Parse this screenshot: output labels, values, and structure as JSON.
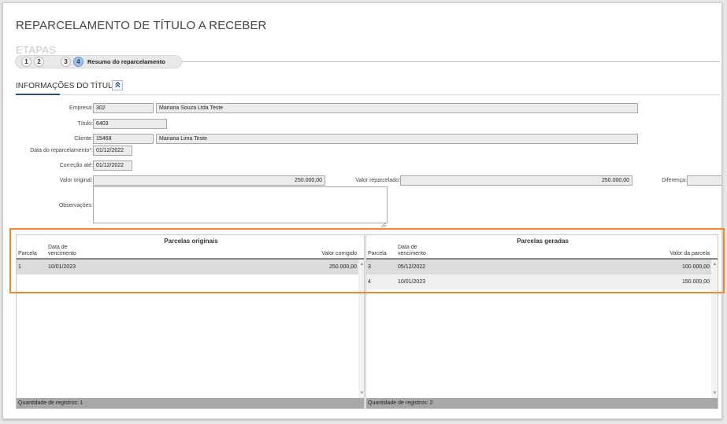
{
  "page": {
    "title": "REPARCELAMENTO DE TÍTULO A RECEBER"
  },
  "steps": {
    "heading": "ETAPAS",
    "items": [
      {
        "number": "1",
        "active": false
      },
      {
        "number": "2",
        "active": false
      },
      {
        "number": "3",
        "active": false
      },
      {
        "number": "4",
        "active": true
      }
    ],
    "active_label": "Resumo do reparcelamento"
  },
  "section": {
    "title": "INFORMAÇÕES DO TÍTULO",
    "toggle_icon": "chevron-double-up-icon",
    "collapse_symbol": "⌃"
  },
  "form": {
    "empresa": {
      "label": "Empresa:",
      "code": "302",
      "name": "Mariana Souza Ltda Teste"
    },
    "titulo": {
      "label": "Título:",
      "value": "6403"
    },
    "cliente": {
      "label": "Cliente:",
      "code": "15468",
      "name": "Mariana Lima Teste"
    },
    "data_reparcelamento": {
      "label": "Data do reparcelamento*:",
      "value": "01/12/2022"
    },
    "correcao_ate": {
      "label": "Correção até:",
      "value": "01/12/2022"
    },
    "valor_original": {
      "label": "Valor original:",
      "value": "250.000,00"
    },
    "valor_reparcelado": {
      "label": "Valor reparcelado:",
      "value": "250.000,00"
    },
    "diferenca": {
      "label": "Diferença:",
      "value": ""
    },
    "observacoes": {
      "label": "Observações:",
      "value": ""
    }
  },
  "parcelas_originais": {
    "title": "Parcelas originais",
    "columns": {
      "parcela": "Parcela",
      "vencimento_1": "Data de",
      "vencimento_2": "vencimento",
      "valor": "Valor corrigido"
    },
    "rows": [
      {
        "parcela": "1",
        "vencimento": "10/01/2023",
        "valor": "250.000,00"
      }
    ],
    "footer": "Quantidade de registros: 1"
  },
  "parcelas_geradas": {
    "title": "Parcelas geradas",
    "columns": {
      "parcela": "Parcela",
      "vencimento_1": "Data de",
      "vencimento_2": "vencimento",
      "valor": "Valor da parcela"
    },
    "rows": [
      {
        "parcela": "3",
        "vencimento": "05/12/2022",
        "valor": "100.000,00"
      },
      {
        "parcela": "4",
        "vencimento": "10/01/2023",
        "valor": "150.000,00"
      }
    ],
    "footer": "Quantidade de registros: 2"
  },
  "scroll": {
    "up": "▲",
    "down": "▼"
  },
  "colors": {
    "highlight": "#f08a2c",
    "step_active": "#9fc3e8",
    "accent": "#2b4c86"
  }
}
